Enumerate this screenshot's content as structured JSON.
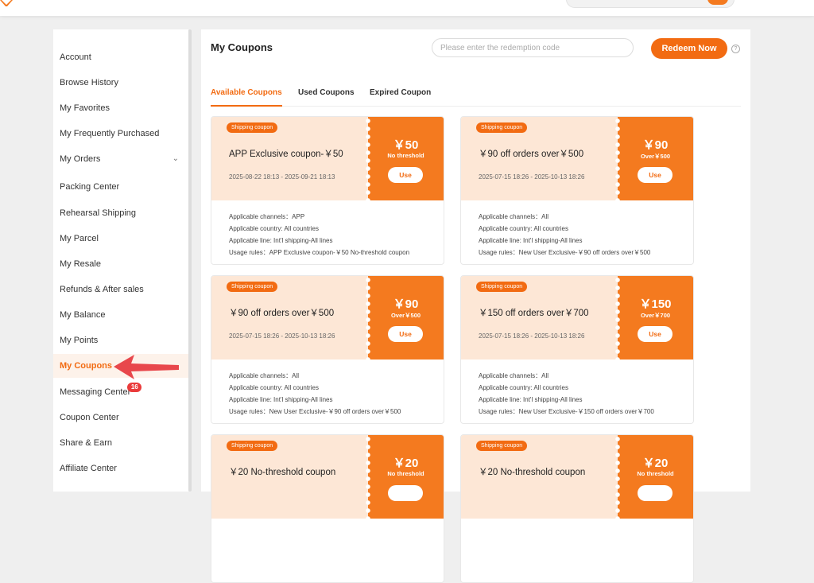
{
  "sidebar": {
    "items": [
      {
        "label": "Account"
      },
      {
        "label": "Browse History"
      },
      {
        "label": "My Favorites"
      },
      {
        "label": "My Frequently Purchased"
      },
      {
        "label": "My Orders"
      },
      {
        "label": "Packing Center"
      },
      {
        "label": "Rehearsal Shipping"
      },
      {
        "label": "My Parcel"
      },
      {
        "label": "My Resale"
      },
      {
        "label": "Refunds & After sales"
      },
      {
        "label": "My Balance"
      },
      {
        "label": "My Points"
      },
      {
        "label": "My Coupons"
      },
      {
        "label": "Messaging Center",
        "badge": "16"
      },
      {
        "label": "Coupon Center"
      },
      {
        "label": "Share & Earn"
      },
      {
        "label": "Affiliate Center"
      }
    ],
    "active": "My Coupons"
  },
  "main": {
    "title": "My Coupons",
    "redeem_placeholder": "Please enter the redemption code",
    "redeem_button": "Redeem Now",
    "help_icon": "?",
    "tabs": [
      {
        "label": "Available Coupons"
      },
      {
        "label": "Used Coupons"
      },
      {
        "label": "Expired Coupon"
      }
    ]
  },
  "coupons": [
    {
      "tag": "Shipping coupon",
      "title": "APP Exclusive coupon-￥50",
      "date": "2025-08-22 18:13 - 2025-09-21 18:13",
      "amount": "￥50",
      "condition": "No threshold",
      "use": "Use",
      "channels": "Applicable channels：APP",
      "country": "Applicable country: All countries",
      "line": "Applicable line: Int'l shipping-All lines",
      "rules": "Usage rules：APP Exclusive coupon-￥50 No-threshold coupon"
    },
    {
      "tag": "Shipping coupon",
      "title": "￥90 off orders over￥500",
      "date": "2025-07-15 18:26 - 2025-10-13 18:26",
      "amount": "￥90",
      "condition": "Over￥500",
      "use": "Use",
      "channels": "Applicable channels：All",
      "country": "Applicable country: All countries",
      "line": "Applicable line: Int'l shipping-All lines",
      "rules": "Usage rules：New User Exclusive-￥90 off orders over￥500"
    },
    {
      "tag": "Shipping coupon",
      "title": "￥90 off orders over￥500",
      "date": "2025-07-15 18:26 - 2025-10-13 18:26",
      "amount": "￥90",
      "condition": "Over￥500",
      "use": "Use",
      "channels": "Applicable channels：All",
      "country": "Applicable country: All countries",
      "line": "Applicable line: Int'l shipping-All lines",
      "rules": "Usage rules：New User Exclusive-￥90 off orders over￥500"
    },
    {
      "tag": "Shipping coupon",
      "title": "￥150 off orders over￥700",
      "date": "2025-07-15 18:26 - 2025-10-13 18:26",
      "amount": "￥150",
      "condition": "Over￥700",
      "use": "Use",
      "channels": "Applicable channels：All",
      "country": "Applicable country: All countries",
      "line": "Applicable line: Int'l shipping-All lines",
      "rules": "Usage rules：New User Exclusive-￥150 off orders over￥700"
    },
    {
      "tag": "Shipping coupon",
      "title": "￥20 No-threshold coupon",
      "amount": "￥20",
      "condition": "No threshold"
    },
    {
      "tag": "Shipping coupon",
      "title": "￥20 No-threshold coupon",
      "amount": "￥20",
      "condition": "No threshold"
    }
  ],
  "colors": {
    "accent": "#f26b12",
    "coupon_light": "#fde7d6",
    "coupon_dark": "#f47a1f",
    "badge": "#ea3b3b",
    "annotation_arrow": "#e8474c"
  }
}
